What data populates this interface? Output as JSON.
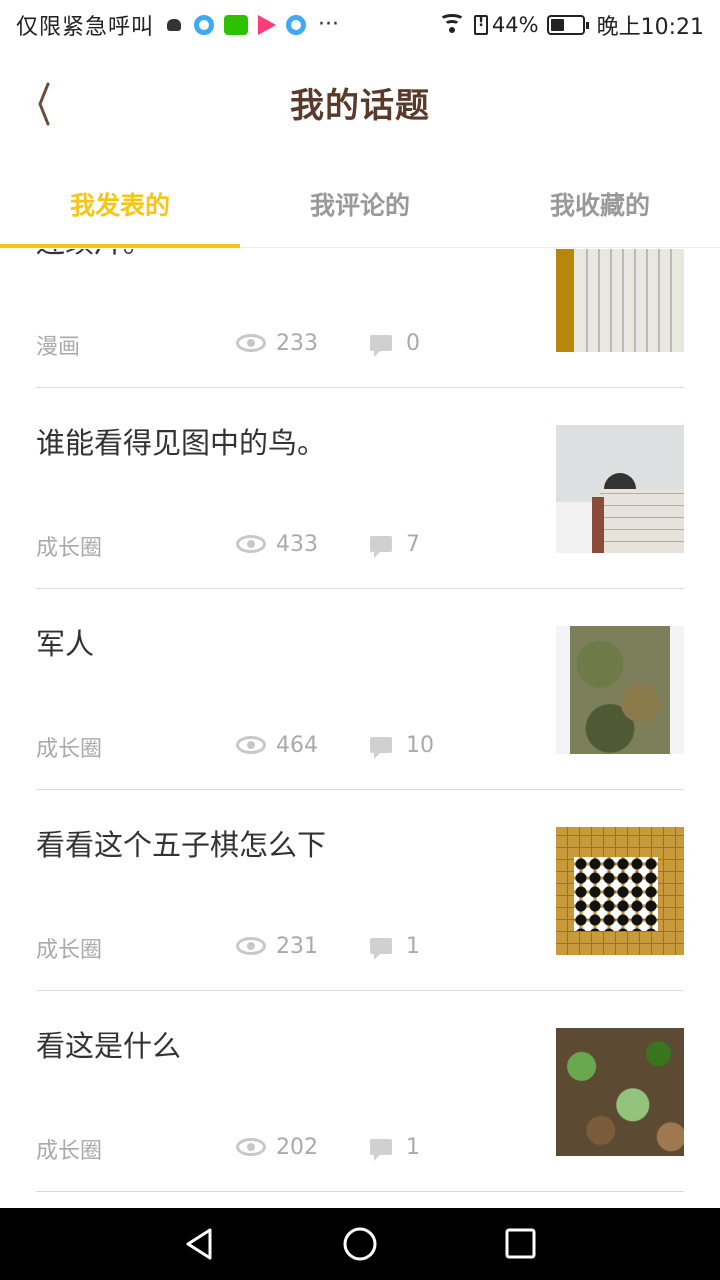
{
  "status_bar": {
    "carrier": "仅限紧急呼叫",
    "battery": "44%",
    "battery_level": 0.44,
    "time": "晚上10:21"
  },
  "header": {
    "title": "我的话题"
  },
  "tabs": [
    {
      "label": "我发表的",
      "active": true
    },
    {
      "label": "我评论的",
      "active": false
    },
    {
      "label": "我收藏的",
      "active": false
    }
  ],
  "topics": [
    {
      "title": "连续片。",
      "category": "漫画",
      "views": "233",
      "comments": "0",
      "thumb": "sketch"
    },
    {
      "title": "谁能看得见图中的鸟。",
      "category": "成长圈",
      "views": "433",
      "comments": "7",
      "thumb": "wall"
    },
    {
      "title": "军人",
      "category": "成长圈",
      "views": "464",
      "comments": "10",
      "thumb": "soldier"
    },
    {
      "title": "看看这个五子棋怎么下",
      "category": "成长圈",
      "views": "231",
      "comments": "1",
      "thumb": "gomoku"
    },
    {
      "title": "看这是什么",
      "category": "成长圈",
      "views": "202",
      "comments": "1",
      "thumb": "leaves"
    }
  ],
  "colors": {
    "accent": "#f5c518",
    "title": "#5a3a2a"
  }
}
